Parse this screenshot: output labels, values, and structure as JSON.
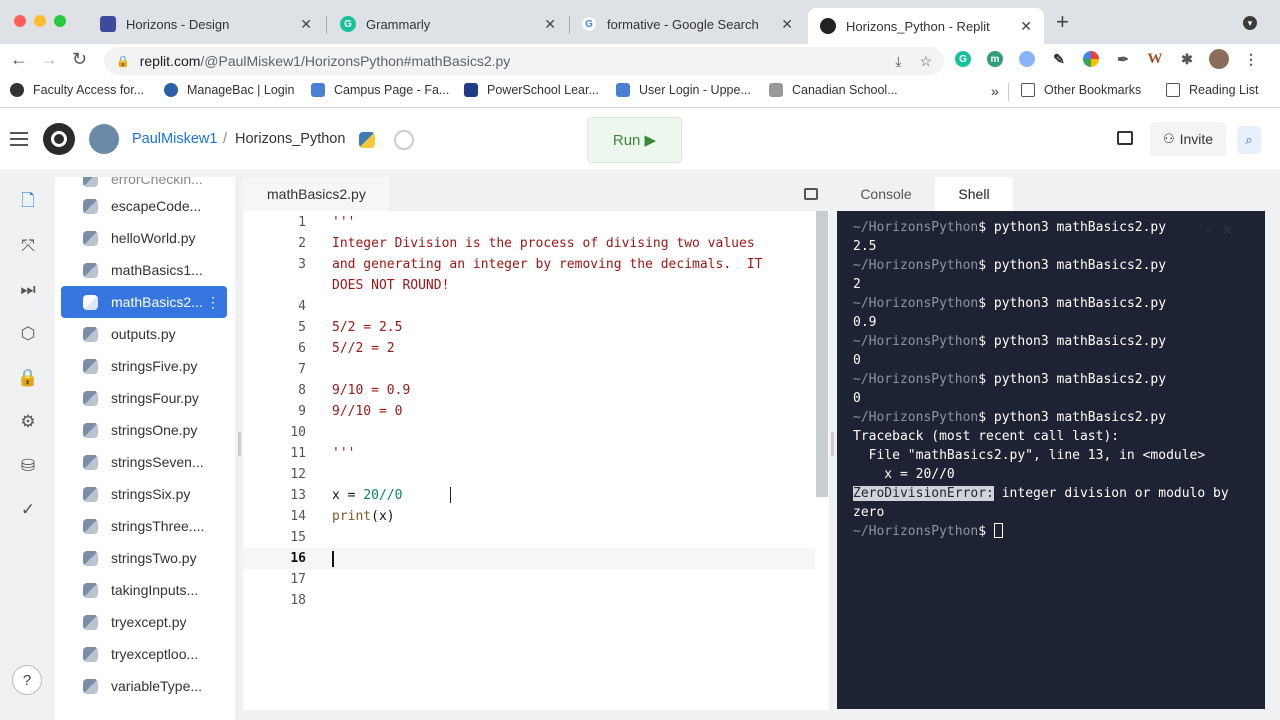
{
  "browser": {
    "tabs": [
      {
        "title": "Horizons - Design",
        "icon": "canva-icon",
        "color": "#3e4a9e"
      },
      {
        "title": "Grammarly",
        "icon": "grammarly-icon",
        "color": "#15c39a"
      },
      {
        "title": "formative - Google Search",
        "icon": "google-icon",
        "color": "#4285f4"
      },
      {
        "title": "Horizons_Python - Replit",
        "icon": "replit-icon",
        "color": "#222222"
      }
    ],
    "url_domain": "replit.com",
    "url_path": "/@PaulMiskew1/HorizonsPython#mathBasics2.py",
    "bookmarks": [
      "Faculty Access for...",
      "ManageBac | Login",
      "Campus Page - Fa...",
      "PowerSchool Lear...",
      "User Login - Uppe...",
      "Canadian School..."
    ],
    "bookmarks_overflow": "»",
    "other_bookmarks": "Other Bookmarks",
    "reading_list": "Reading List"
  },
  "header": {
    "username": "PaulMiskew1",
    "separator": "/",
    "repl_name": "Horizons_Python",
    "run_label": "Run ▶",
    "invite_label": "Invite"
  },
  "files": {
    "cut_top": "errorCheckin...",
    "items": [
      "escapeCode...",
      "helloWorld.py",
      "mathBasics1...",
      "mathBasics2...",
      "outputs.py",
      "stringsFive.py",
      "stringsFour.py",
      "stringsOne.py",
      "stringsSeven...",
      "stringsSix.py",
      "stringsThree....",
      "stringsTwo.py",
      "takingInputs...",
      "tryexcept.py",
      "tryexceptloo...",
      "variableType..."
    ],
    "active_index": 3
  },
  "editor": {
    "tab": "mathBasics2.py",
    "lines": [
      {
        "n": "1",
        "t": "'''"
      },
      {
        "n": "2",
        "t": "Integer Division is the process of divising two values"
      },
      {
        "n": "3",
        "t": "and generating an integer by removing the decimals.  IT"
      },
      {
        "n": "",
        "t": "DOES NOT ROUND!"
      },
      {
        "n": "4",
        "t": ""
      },
      {
        "n": "5",
        "t": "5/2 = 2.5"
      },
      {
        "n": "6",
        "t": "5//2 = 2"
      },
      {
        "n": "7",
        "t": ""
      },
      {
        "n": "8",
        "t": "9/10 = 0.9"
      },
      {
        "n": "9",
        "t": "9//10 = 0"
      },
      {
        "n": "10",
        "t": ""
      },
      {
        "n": "11",
        "t": "'''"
      },
      {
        "n": "12",
        "t": ""
      },
      {
        "n": "13",
        "t": "x = 20//0"
      },
      {
        "n": "14",
        "t": "print(x)"
      },
      {
        "n": "15",
        "t": ""
      },
      {
        "n": "16",
        "t": ""
      },
      {
        "n": "17",
        "t": ""
      },
      {
        "n": "18",
        "t": ""
      }
    ],
    "current_line": "16"
  },
  "console": {
    "tabs": [
      "Console",
      "Shell"
    ],
    "active_tab": "Shell",
    "prompt": "~/HorizonsPython",
    "lines": [
      {
        "prompt": "~/HorizonsPython",
        "cmd": "$ python3 mathBasics2.py"
      },
      {
        "out": "2.5"
      },
      {
        "prompt": "~/HorizonsPython",
        "cmd": "$ python3 mathBasics2.py"
      },
      {
        "out": "2"
      },
      {
        "prompt": "~/HorizonsPython",
        "cmd": "$ python3 mathBasics2.py"
      },
      {
        "out": "0.9"
      },
      {
        "prompt": "~/HorizonsPython",
        "cmd": "$ python3 mathBasics2.py"
      },
      {
        "out": "0"
      },
      {
        "prompt": "~/HorizonsPython",
        "cmd": "$ python3 mathBasics2.py"
      },
      {
        "out": "0"
      },
      {
        "prompt": "~/HorizonsPython",
        "cmd": "$ python3 mathBasics2.py"
      },
      {
        "out": "Traceback (most recent call last):"
      },
      {
        "out": "  File \"mathBasics2.py\", line 13, in <module>"
      },
      {
        "out": "    x = 20//0"
      },
      {
        "err": "ZeroDivisionError:",
        "out": " integer division or modulo by"
      },
      {
        "out": "zero"
      },
      {
        "prompt": "~/HorizonsPython",
        "cmd": "$ ",
        "cursor": true
      }
    ]
  },
  "colors": {
    "accent": "#3576e0",
    "code_string": "#a31515",
    "terminal_bg": "#1d2333",
    "run_green": "#3a8a3a"
  }
}
